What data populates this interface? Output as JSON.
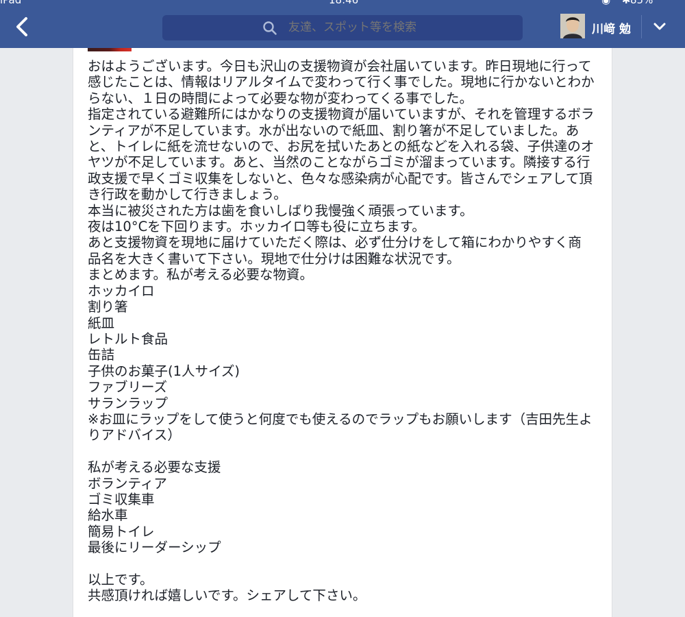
{
  "status_bar": {
    "carrier": "iPad",
    "time": "18:46",
    "battery": "85%"
  },
  "nav": {
    "search_placeholder": "友達、スポット等を検索",
    "user_name": "川﨑 勉"
  },
  "post": {
    "paragraphs": [
      "おはようございます。今日も沢山の支援物資が会社届いています。昨日現地に行って感じたことは、情報はリアルタイムで変わって行く事でした。現地に行かないとわからない、１日の時間によって必要な物が変わってくる事でした。",
      "指定されている避難所にはかなりの支援物資が届いていますが、それを管理するボランティアが不足しています。水が出ないので紙皿、割り箸が不足していました。あと、トイレに紙を流せないので、お尻を拭いたあとの紙などを入れる袋、子供達のオヤツが不足しています。あと、当然のことながらゴミが溜まっています。隣接する行政支援で早くゴミ収集をしないと、色々な感染病が心配です。皆さんでシェアして頂き行政を動かして行きましょう。",
      "本当に被災された方は歯を食いしばり我慢強く頑張っています。",
      "夜は10°Cを下回ります。ホッカイロ等も役に立ちます。",
      "あと支援物資を現地に届けていただく際は、必ず仕分けをして箱にわかりやすく商品名を大きく書いて下さい。現地で仕分けは困難な状況です。",
      "まとめます。私が考える必要な物資。"
    ],
    "supplies": [
      "ホッカイロ",
      "割り箸",
      "紙皿",
      "レトルト食品",
      "缶詰",
      "子供のお菓子(1人サイズ)",
      "ファブリーズ",
      "サランラップ"
    ],
    "note": "※お皿にラップをして使うと何度でも使えるのでラップもお願いします（吉田先生よりアドバイス）",
    "support_heading": "私が考える必要な支援",
    "support_items": [
      "ボランティア",
      "ゴミ収集車",
      "給水車",
      "簡易トイレ",
      "最後にリーダーシップ"
    ],
    "closing_1": "以上です。",
    "closing_2": "共感頂ければ嬉しいです。シェアして下さい。"
  },
  "colors": {
    "nav_bg": "#3b5998",
    "search_bg": "#2d4486",
    "page_bg": "#e9ebee",
    "text": "#1d2129"
  },
  "icons": {
    "back": "back-chevron-icon",
    "search": "search-icon",
    "menu": "chevron-down-icon"
  }
}
